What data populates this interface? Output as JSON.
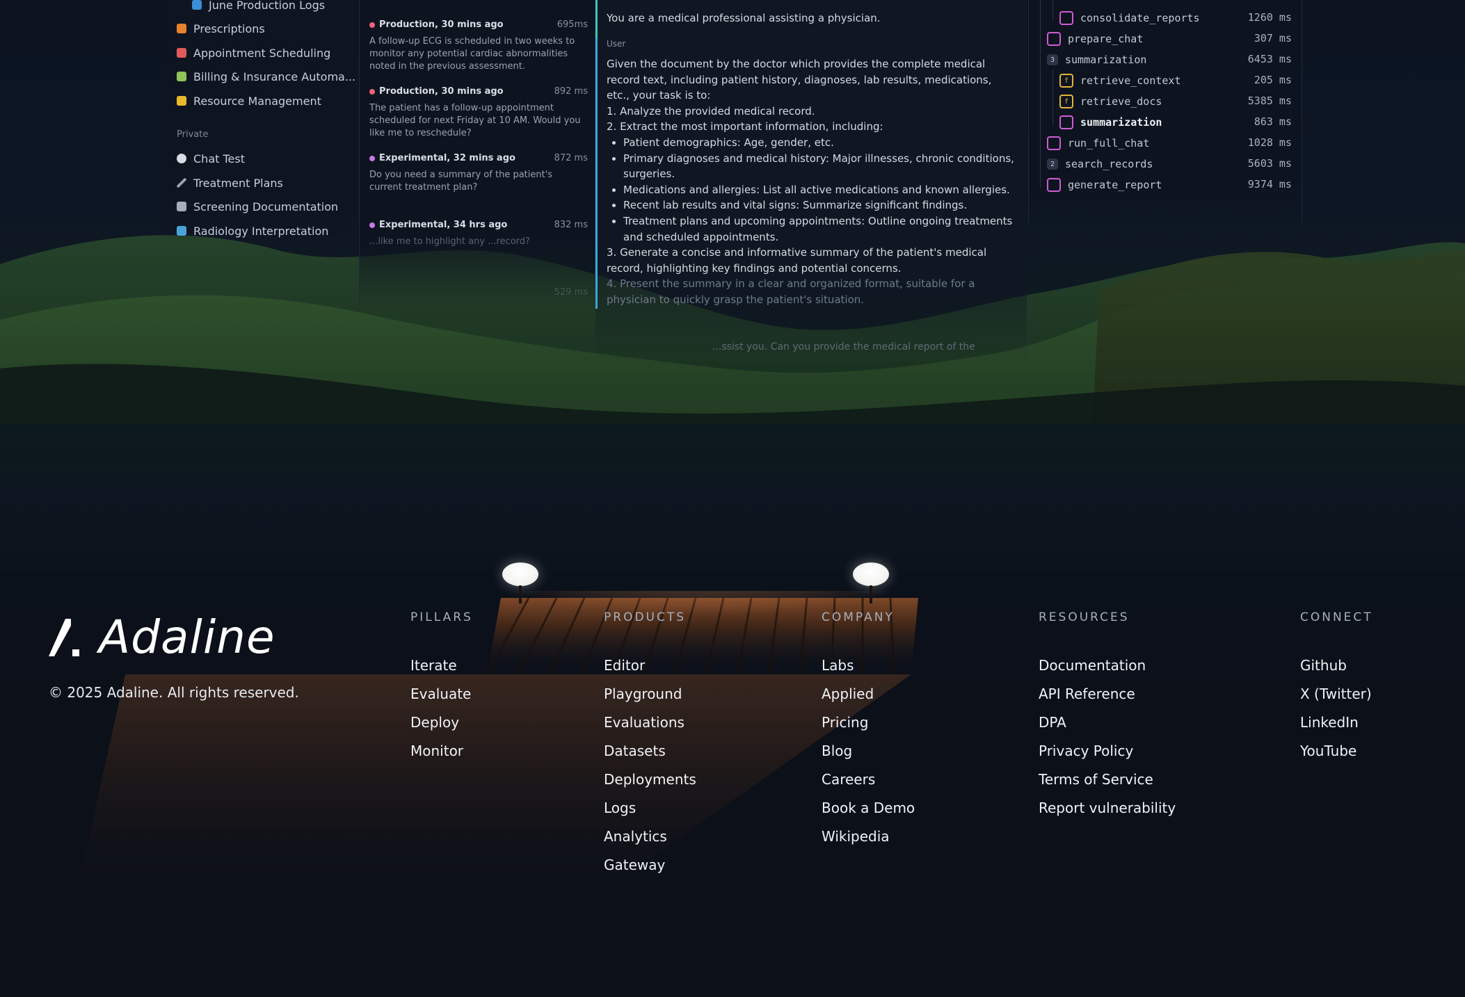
{
  "sidebar": {
    "items_top": [
      {
        "label": "June Production Logs",
        "icon": "database-icon"
      },
      {
        "label": "Prescriptions",
        "icon": "pill-icon"
      },
      {
        "label": "Appointment Scheduling",
        "icon": "calendar-icon"
      },
      {
        "label": "Billing & Insurance Automa...",
        "icon": "puzzle-icon"
      },
      {
        "label": "Resource Management",
        "icon": "bell-icon"
      }
    ],
    "private_label": "Private",
    "items_private": [
      {
        "label": "Chat Test",
        "icon": "chat-bubble-icon"
      },
      {
        "label": "Treatment Plans",
        "icon": "pen-icon"
      },
      {
        "label": "Screening Documentation",
        "icon": "robot-icon"
      },
      {
        "label": "Radiology Interpretation",
        "icon": "abacus-icon"
      }
    ]
  },
  "logs": [
    {
      "env": "Production, 30 mins ago",
      "ms": "695ms",
      "text": "A follow-up ECG is scheduled in two weeks to monitor any potential cardiac abnormalities noted in the previous assessment.",
      "color": "#f0637a"
    },
    {
      "env": "Production, 30 mins ago",
      "ms": "892 ms",
      "text": "The patient has a follow-up appointment scheduled for next Friday at 10 AM. Would you like me to reschedule?",
      "color": "#f0637a"
    },
    {
      "env": "Experimental, 32 mins ago",
      "ms": "872 ms",
      "text": "Do you need a summary of the patient's current treatment plan?",
      "color": "#c77ae6"
    },
    {
      "env": "Experimental, 34 hrs ago",
      "ms": "832 ms",
      "text": "...like me to highlight any ...record?",
      "color": "#c77ae6"
    },
    {
      "ms": "529 ms"
    }
  ],
  "chat": {
    "system_text": "You are a medical professional assisting a physician.",
    "user_role": "User",
    "intro": "Given the document by the doctor which provides the complete medical record text, including patient history, diagnoses, lab results, medications, etc., your task is to:",
    "step1": "1. Analyze the provided medical record.",
    "step2": "2. Extract the most important information, including:",
    "bullets": [
      "Patient demographics: Age, gender, etc.",
      "Primary diagnoses and medical history:  Major illnesses, chronic conditions, surgeries.",
      "Medications and allergies: List all active medications and known allergies.",
      "Recent lab results and vital signs: Summarize significant findings.",
      "Treatment plans and upcoming appointments: Outline ongoing treatments and scheduled appointments."
    ],
    "step3": "3. Generate a concise and informative summary of the patient's medical record, highlighting key findings and potential concerns.",
    "step4": "4. Present the summary in a clear and organized format, suitable for a physician to quickly grasp the patient's situation.",
    "assistant_fragment": "...ssist you. Can you provide the medical report of the"
  },
  "trace": [
    {
      "name": "consolidate_reports",
      "ms": "1260 ms",
      "badge": "chat",
      "depth": 1
    },
    {
      "name": "prepare_chat",
      "ms": "307 ms",
      "badge": "chat",
      "depth": 0
    },
    {
      "name": "summarization",
      "ms": "6453 ms",
      "badge": "3",
      "depth": 0
    },
    {
      "name": "retrieve_context",
      "ms": "205 ms",
      "badge": "fn",
      "depth": 1
    },
    {
      "name": "retrieve_docs",
      "ms": "5385 ms",
      "badge": "fn",
      "depth": 1
    },
    {
      "name": "summarization",
      "ms": "863 ms",
      "badge": "chat",
      "depth": 1,
      "bold": true
    },
    {
      "name": "run_full_chat",
      "ms": "1028 ms",
      "badge": "chat",
      "depth": 0
    },
    {
      "name": "search_records",
      "ms": "5603 ms",
      "badge": "2",
      "depth": 0
    },
    {
      "name": "generate_report",
      "ms": "9374 ms",
      "badge": "chat",
      "depth": 0
    }
  ],
  "footer": {
    "brand": "Adaline",
    "copyright": "© 2025 Adaline. All rights reserved.",
    "columns": [
      {
        "title": "PILLARS",
        "links": [
          "Iterate",
          "Evaluate",
          "Deploy",
          "Monitor"
        ]
      },
      {
        "title": "PRODUCTS",
        "links": [
          "Editor",
          "Playground",
          "Evaluations",
          "Datasets",
          "Deployments",
          "Logs",
          "Analytics",
          "Gateway"
        ]
      },
      {
        "title": "COMPANY",
        "links": [
          "Labs",
          "Applied",
          "Pricing",
          "Blog",
          "Careers",
          "Book a Demo",
          "Wikipedia"
        ]
      },
      {
        "title": "RESOURCES",
        "links": [
          "Documentation",
          "API Reference",
          "DPA",
          "Privacy Policy",
          "Terms of Service",
          "Report vulnerability"
        ]
      },
      {
        "title": "CONNECT",
        "links": [
          "Github",
          "X (Twitter)",
          "LinkedIn",
          "YouTube"
        ]
      }
    ]
  }
}
